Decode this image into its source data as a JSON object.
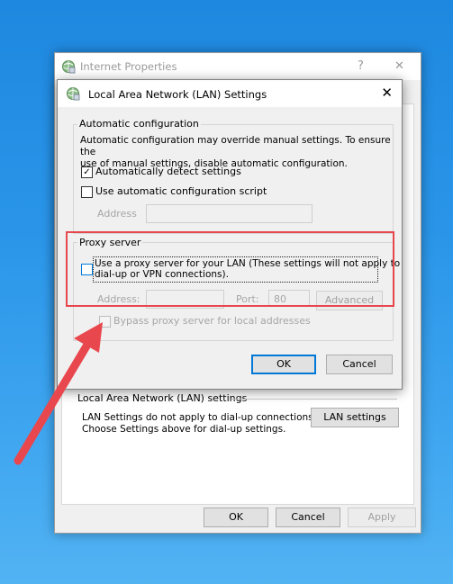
{
  "outer_window": {
    "title": "Internet Properties",
    "help_glyph": "?",
    "close_glyph": "✕",
    "lan_group_label": "Local Area Network (LAN) settings",
    "lan_text_line1": "LAN Settings do not apply to dial-up connections.",
    "lan_text_line2": "Choose Settings above for dial-up settings.",
    "lan_settings_button": "LAN settings",
    "ok_button": "OK",
    "cancel_button": "Cancel",
    "apply_button": "Apply"
  },
  "lan_dialog": {
    "title": "Local Area Network (LAN) Settings",
    "close_glyph": "✕",
    "auto_config": {
      "group_label": "Automatic configuration",
      "description_line1": "Automatic configuration may override manual settings.  To ensure the",
      "description_line2": "use of manual settings, disable automatic configuration.",
      "auto_detect_label": "Automatically detect settings",
      "auto_detect_checked": true,
      "auto_detect_mark": "✓",
      "script_label": "Use automatic configuration script",
      "script_checked": false,
      "address_label": "Address",
      "address_value": ""
    },
    "proxy": {
      "group_label": "Proxy server",
      "use_proxy_line1": "Use a proxy server for your LAN (These settings will not apply to",
      "use_proxy_line2": "dial-up or VPN connections).",
      "use_proxy_checked": false,
      "address_label": "Address:",
      "address_value": "",
      "port_label": "Port:",
      "port_value": "80",
      "advanced_button": "Advanced",
      "bypass_label": "Bypass proxy server for local addresses",
      "bypass_checked": false
    },
    "ok_button": "OK",
    "cancel_button": "Cancel"
  },
  "colors": {
    "highlight_box": "#e8474e",
    "arrow": "#e8474e",
    "focus_blue": "#0078d7"
  },
  "icons": [
    "internet-options-icon",
    "close-icon",
    "help-icon",
    "red-arrow"
  ]
}
